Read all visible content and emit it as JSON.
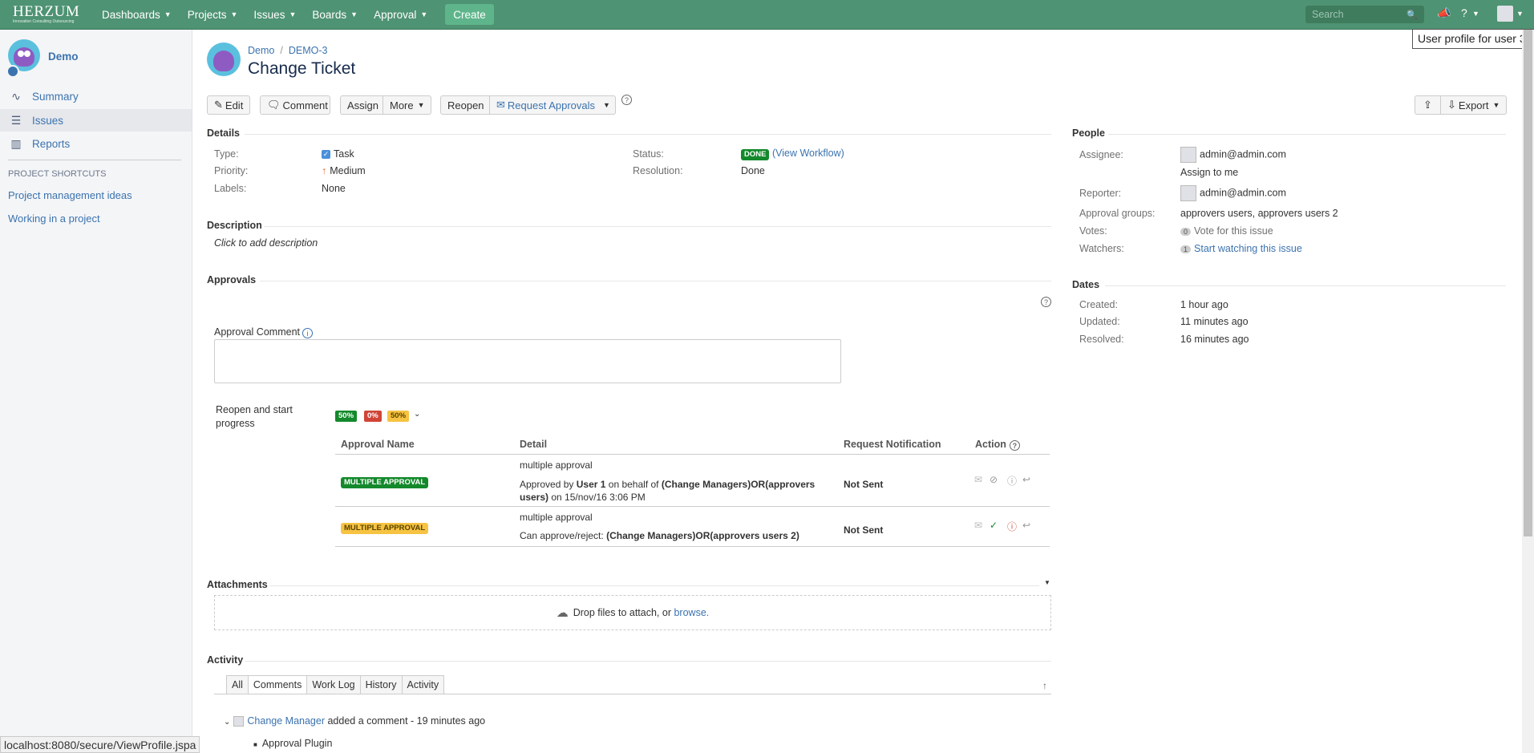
{
  "topnav": {
    "logo": "HERZUM",
    "logo_tagline": "Innovation Consulting Outsourcing",
    "menu": [
      {
        "label": "Dashboards"
      },
      {
        "label": "Projects"
      },
      {
        "label": "Issues"
      },
      {
        "label": "Boards"
      },
      {
        "label": "Approval"
      }
    ],
    "create_label": "Create",
    "search_placeholder": "Search",
    "tooltip": "User profile for user 3"
  },
  "sidebar": {
    "project_name": "Demo",
    "items": [
      {
        "label": "Summary",
        "icon": "pulse-icon"
      },
      {
        "label": "Issues",
        "icon": "issues-icon"
      },
      {
        "label": "Reports",
        "icon": "chart-icon"
      }
    ],
    "shortcuts_heading": "PROJECT SHORTCUTS",
    "shortcuts": [
      "Project management ideas",
      "Working in a project"
    ]
  },
  "status_bar": "localhost:8080/secure/ViewProfile.jspa",
  "issue": {
    "breadcrumb": [
      "Demo",
      "DEMO-3"
    ],
    "title": "Change Ticket"
  },
  "toolbar": {
    "edit": "Edit",
    "comment": "Comment",
    "assign": "Assign",
    "more": "More",
    "reopen": "Reopen",
    "request_approvals": "Request Approvals",
    "export": "Export"
  },
  "details": {
    "heading": "Details",
    "type_label": "Type:",
    "type_value": "Task",
    "priority_label": "Priority:",
    "priority_value": "Medium",
    "labels_label": "Labels:",
    "labels_value": "None",
    "status_label": "Status:",
    "status_value": "DONE",
    "view_workflow": "(View Workflow)",
    "resolution_label": "Resolution:",
    "resolution_value": "Done"
  },
  "description": {
    "heading": "Description",
    "placeholder": "Click to add description"
  },
  "approvals": {
    "heading": "Approvals",
    "comment_label": "Approval Comment",
    "transition": "Reopen and start progress",
    "progress": [
      "50%",
      "0%",
      "50%"
    ],
    "columns": [
      "Approval Name",
      "Detail",
      "Request Notification",
      "Action"
    ],
    "rows": [
      {
        "name": "MULTIPLE APPROVAL",
        "detail_title": "multiple approval",
        "detail_prefix": "Approved by",
        "detail_user": "User 1",
        "detail_mid": "on behalf of",
        "detail_groups_1": "(Change Managers)OR(approvers",
        "detail_groups_2": "users)",
        "detail_date": "on 15/nov/16 3:06 PM",
        "notification": "Not Sent",
        "status_color": "#14892c"
      },
      {
        "name": "MULTIPLE APPROVAL",
        "detail_title": "multiple approval",
        "detail_prefix": "Can approve/reject:",
        "detail_groups_1": "(Change Managers)OR(approvers users 2)",
        "notification": "Not Sent",
        "status_color": "#f6c342"
      }
    ]
  },
  "attachments": {
    "heading": "Attachments",
    "drop_text": "Drop files to attach, or",
    "browse": "browse."
  },
  "activity": {
    "heading": "Activity",
    "tabs": [
      "All",
      "Comments",
      "Work Log",
      "History",
      "Activity"
    ],
    "comment_author": "Change Manager",
    "comment_action": "added a comment - 19 minutes ago",
    "comment_body": "Approval Plugin"
  },
  "people": {
    "heading": "People",
    "assignee_label": "Assignee:",
    "assignee": "admin@admin.com",
    "assign_to_me": "Assign to me",
    "reporter_label": "Reporter:",
    "reporter": "admin@admin.com",
    "groups_label": "Approval groups:",
    "groups": "approvers users, approvers users 2",
    "votes_label": "Votes:",
    "votes_count": "0",
    "vote_link": "Vote for this issue",
    "watchers_label": "Watchers:",
    "watchers_count": "1",
    "watch_link": "Start watching this issue"
  },
  "dates": {
    "heading": "Dates",
    "created_label": "Created:",
    "created": "1 hour ago",
    "updated_label": "Updated:",
    "updated": "11 minutes ago",
    "resolved_label": "Resolved:",
    "resolved": "16 minutes ago"
  }
}
